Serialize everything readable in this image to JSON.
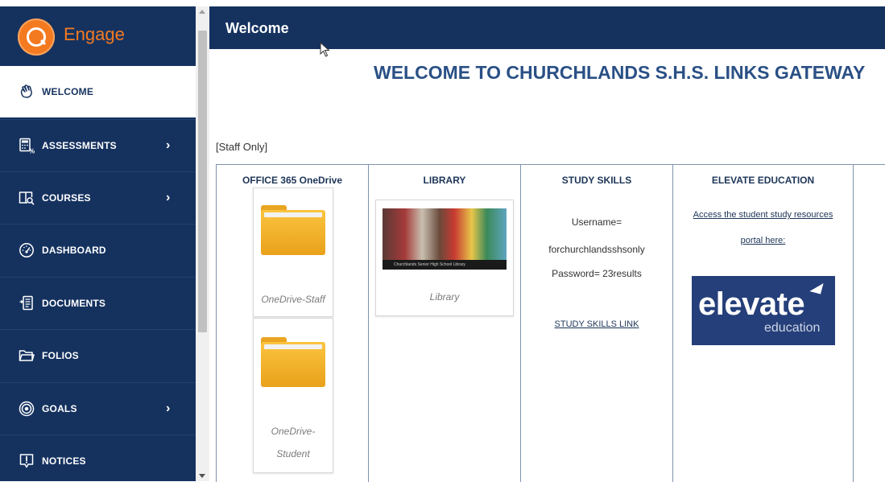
{
  "brand": {
    "name": "Engage",
    "logo_color": "#f47a20"
  },
  "sidebar": {
    "background": "#15325f",
    "items": [
      {
        "label": "WELCOME",
        "icon": "hand-wave-icon",
        "active": true,
        "chevron": ""
      },
      {
        "label": "ASSESSMENTS",
        "icon": "calculator-percent-icon",
        "active": false,
        "chevron": "›"
      },
      {
        "label": "COURSES",
        "icon": "book-search-icon",
        "active": false,
        "chevron": "›"
      },
      {
        "label": "DASHBOARD",
        "icon": "gauge-icon",
        "active": false,
        "chevron": ""
      },
      {
        "label": "DOCUMENTS",
        "icon": "document-list-icon",
        "active": false,
        "chevron": ""
      },
      {
        "label": "FOLIOS",
        "icon": "folder-outline-icon",
        "active": false,
        "chevron": ""
      },
      {
        "label": "GOALS",
        "icon": "target-icon",
        "active": false,
        "chevron": "›"
      },
      {
        "label": "NOTICES",
        "icon": "notice-alert-icon",
        "active": false,
        "chevron": ""
      }
    ]
  },
  "header": {
    "title": "Welcome"
  },
  "main": {
    "heading": "WELCOME TO CHURCHLANDS S.H.S. LINKS GATEWAY",
    "staff_only": "[Staff Only]",
    "columns": {
      "office": {
        "title": "OFFICE 365 OneDrive",
        "tiles": [
          {
            "caption": "OneDrive-Staff",
            "icon": "folder-icon"
          },
          {
            "caption_line1": "OneDrive-",
            "caption_line2": "Student",
            "icon": "folder-icon"
          }
        ]
      },
      "library": {
        "title": "LIBRARY",
        "tile_caption": "Library",
        "photo_caption": "Churchlands Senior High School Library"
      },
      "study": {
        "title": "STUDY SKILLS",
        "username_label": "Username=",
        "username_value": "forchurchlandsshsonly",
        "password": "Password= 23results",
        "link": "STUDY SKILLS LINK"
      },
      "elevate": {
        "title": "ELEVATE EDUCATION",
        "link_line1": "Access the student study resources",
        "link_line2": "portal here:",
        "logo_word": "elevate",
        "logo_sub": "education",
        "logo_color": "#253f7a"
      }
    }
  }
}
